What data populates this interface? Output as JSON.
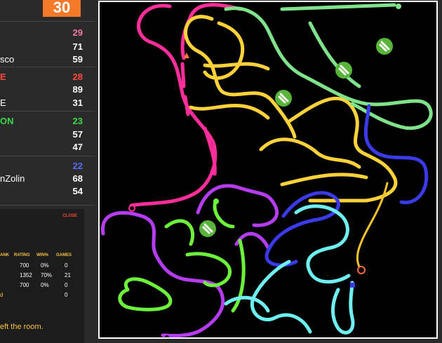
{
  "timer": "30",
  "players": [
    {
      "name": "",
      "score": "29",
      "color": "#f07aa0"
    },
    {
      "name": "",
      "score": "71",
      "color": "#ffffff"
    },
    {
      "name": "sco",
      "score": "59",
      "color": "#ffffff"
    },
    {
      "name": "E",
      "score": "28",
      "color": "#ff4a3d"
    },
    {
      "name": "",
      "score": "89",
      "color": "#ffffff"
    },
    {
      "name": "E",
      "score": "31",
      "color": "#ffffff"
    },
    {
      "name": "ON",
      "score": "23",
      "color": "#3ad84a"
    },
    {
      "name": "",
      "score": "57",
      "color": "#ffffff"
    },
    {
      "name": "",
      "score": "47",
      "color": "#ffffff"
    },
    {
      "name": "",
      "score": "22",
      "color": "#5a6bff"
    },
    {
      "name": "nZolin",
      "score": "68",
      "color": "#ffffff"
    },
    {
      "name": "",
      "score": "54",
      "color": "#ffffff"
    }
  ],
  "panel": {
    "close_label": "CLOSE",
    "headers": [
      "ANK",
      "RATING",
      "WIN%",
      "GAMES"
    ],
    "rows": [
      [
        "",
        "700",
        "0%",
        "0"
      ],
      [
        "",
        "1352",
        "70%",
        "21"
      ],
      [
        "",
        "700",
        "0%",
        "0"
      ],
      [
        "d",
        "",
        "",
        "0"
      ]
    ],
    "message": "eft the room."
  },
  "board": {
    "colors": {
      "pink": "#ff2e9a",
      "yellow": "#ffd23a",
      "light_green": "#7ee38a",
      "purple": "#b53cf0",
      "lime": "#6cf23a",
      "blue": "#3a3ae8",
      "cyan": "#6ff0f0",
      "orange_yellow": "#f2c42a"
    },
    "powerups": [
      "bolt-icon",
      "bolt-icon",
      "bolt-icon",
      "bolt-icon"
    ]
  }
}
